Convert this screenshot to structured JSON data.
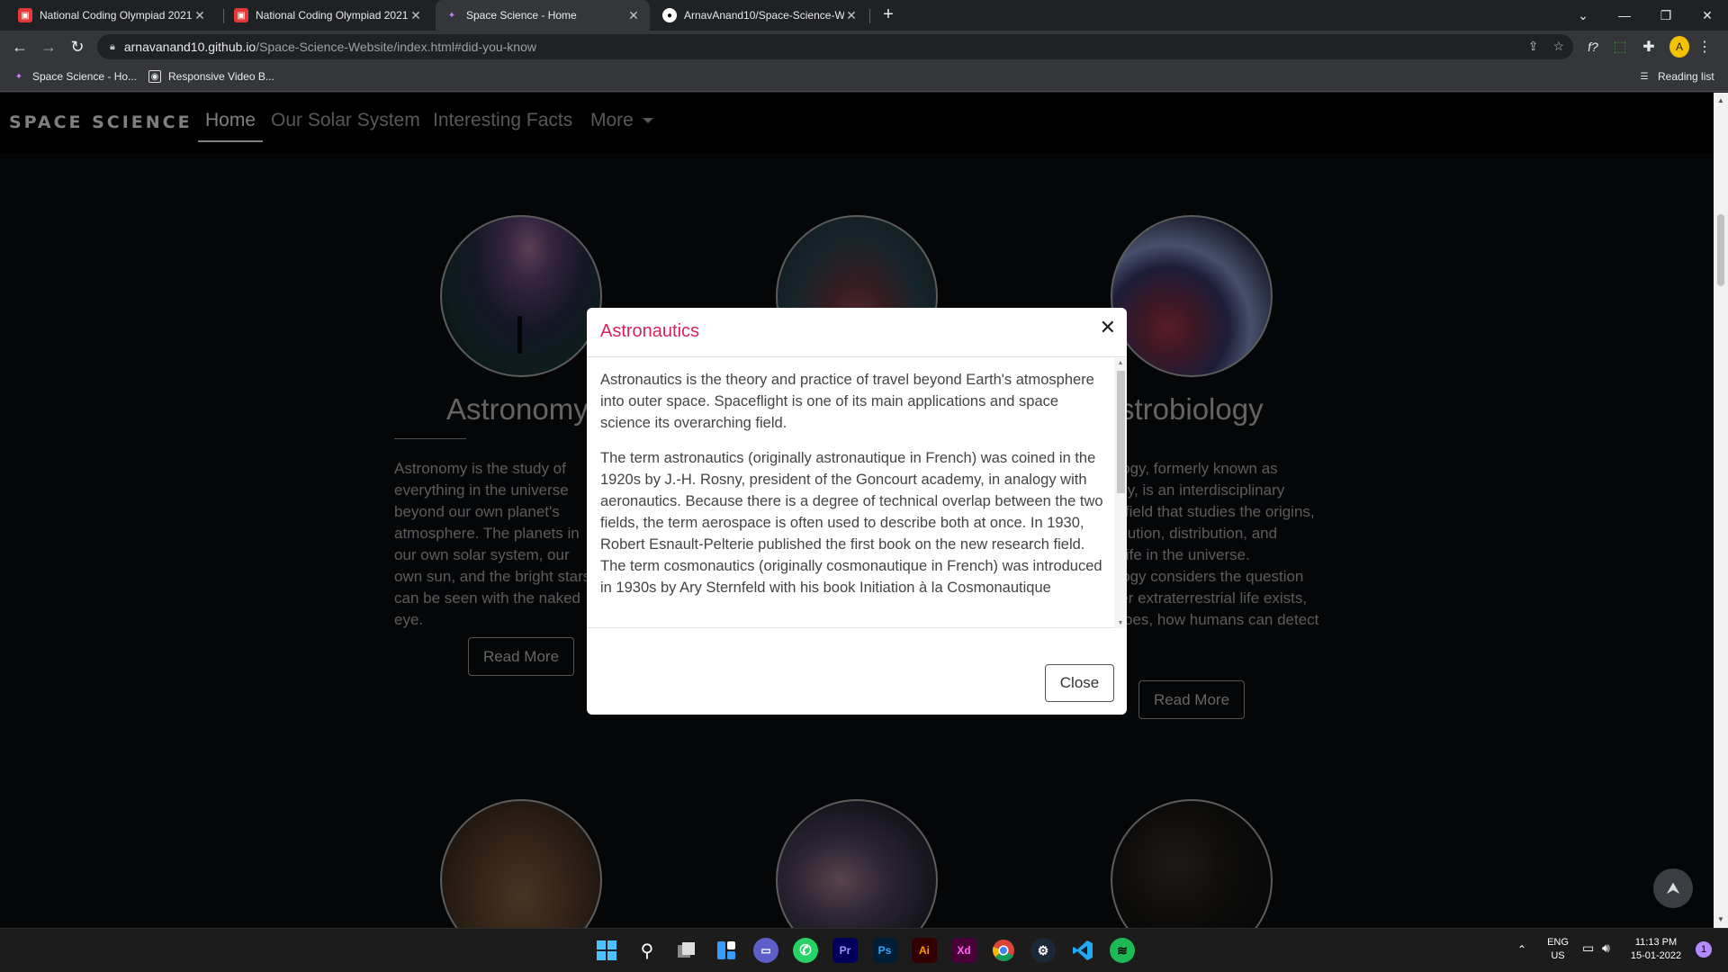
{
  "browser": {
    "tabs": [
      {
        "title": "National Coding Olympiad 2021",
        "active": false
      },
      {
        "title": "National Coding Olympiad 2021",
        "active": false
      },
      {
        "title": "Space Science - Home",
        "active": true
      },
      {
        "title": "ArnavAnand10/Space-Science-W",
        "active": false
      }
    ],
    "url_host": "arnavanand10.github.io",
    "url_path": "/Space-Science-Website/index.html#did-you-know",
    "bookmarks": [
      "Space Science - Ho...",
      "Responsive Video B..."
    ],
    "reading_list": "Reading list"
  },
  "site": {
    "brand": "SPACE SCIENCE",
    "nav": {
      "home": "Home",
      "solar": "Our Solar System",
      "facts": "Interesting Facts",
      "more": "More"
    },
    "cards": {
      "astronomy": {
        "title": "Astronomy",
        "text": "Astronomy is the study of everything in the universe beyond our own planet's atmosphere. The planets in our own solar system, our own sun, and the bright stars can be seen with the naked eye.",
        "button": "Read More"
      },
      "astrobiology": {
        "title": "Astrobiology",
        "text": "Astrobiology, formerly known as exobiology, is an interdisciplinary scientific field that studies the origins, early evolution, distribution, and future of life in the universe. Astrobiology considers the question of whether extraterrestrial life exists, and if it does, how humans can detect it.",
        "button": "Read More"
      }
    }
  },
  "modal": {
    "title": "Astronautics",
    "p1": "Astronautics is the theory and practice of travel beyond Earth's atmosphere into outer space. Spaceflight is one of its main applications and space science its overarching field.",
    "p2": "The term astronautics (originally astronautique in French) was coined in the 1920s by J.-H. Rosny, president of the Goncourt academy, in analogy with aeronautics. Because there is a degree of technical overlap between the two fields, the term aerospace is often used to describe both at once. In 1930, Robert Esnault-Pelterie published the first book on the new research field. The term cosmonautics (originally cosmonautique in French) was introduced in 1930s by Ary Sternfeld with his book Initiation à la Cosmonautique",
    "close": "Close"
  },
  "taskbar": {
    "lang": "ENG",
    "region": "US",
    "time": "11:13 PM",
    "date": "15-01-2022",
    "notifications": "1",
    "apps": [
      "Pr",
      "Ps",
      "Ai",
      "Xd"
    ]
  },
  "colors": {
    "modal_title": "#d6245a",
    "page_bg": "#0a0c10"
  }
}
